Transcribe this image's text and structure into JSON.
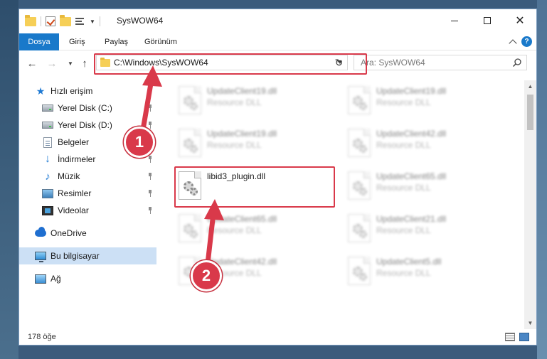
{
  "window": {
    "title": "SysWOW64"
  },
  "ribbon": {
    "tabs": [
      "Dosya",
      "Giriş",
      "Paylaş",
      "Görünüm"
    ]
  },
  "navbar": {
    "address": "C:\\Windows\\SysWOW64",
    "search_placeholder": "Ara: SysWOW64"
  },
  "sidebar": {
    "items": [
      {
        "label": "Hızlı erişim",
        "icon": "star-icon"
      },
      {
        "label": "Yerel Disk (C:)",
        "icon": "drive-icon",
        "pinned": true
      },
      {
        "label": "Yerel Disk (D:)",
        "icon": "drive-icon",
        "pinned": true
      },
      {
        "label": "Belgeler",
        "icon": "document-icon",
        "pinned": true
      },
      {
        "label": "İndirmeler",
        "icon": "download-icon",
        "pinned": true
      },
      {
        "label": "Müzik",
        "icon": "music-icon",
        "pinned": true
      },
      {
        "label": "Resimler",
        "icon": "pictures-icon",
        "pinned": true
      },
      {
        "label": "Videolar",
        "icon": "videos-icon",
        "pinned": true
      },
      {
        "label": "OneDrive",
        "icon": "cloud-icon"
      },
      {
        "label": "Bu bilgisayar",
        "icon": "computer-icon",
        "selected": true
      },
      {
        "label": "Ağ",
        "icon": "network-icon"
      }
    ]
  },
  "files": [
    {
      "name": "UpdateClient19.dll",
      "type": "Resource DLL"
    },
    {
      "name": "UpdateClient19.dll",
      "type": "Resource DLL"
    },
    {
      "name": "UpdateClient19.dll",
      "type": "Resource DLL"
    },
    {
      "name": "UpdateClient42.dll",
      "type": "Resource DLL"
    },
    {
      "name": "libid3_plugin.dll",
      "type": ""
    },
    {
      "name": "UpdateClient65.dll",
      "type": "Resource DLL"
    },
    {
      "name": "UpdateClient65.dll",
      "type": "Resource DLL"
    },
    {
      "name": "UpdateClient21.dll",
      "type": "Resource DLL"
    },
    {
      "name": "UpdateClient42.dll",
      "type": "Resource DLL"
    },
    {
      "name": "UpdateClient5.dll",
      "type": "Resource DLL"
    }
  ],
  "status": {
    "item_count": "178 öğe"
  },
  "callouts": [
    "1",
    "2"
  ],
  "colors": {
    "accent": "#1979ca",
    "highlight": "#d9394a",
    "selected_nav": "#cce0f5"
  }
}
